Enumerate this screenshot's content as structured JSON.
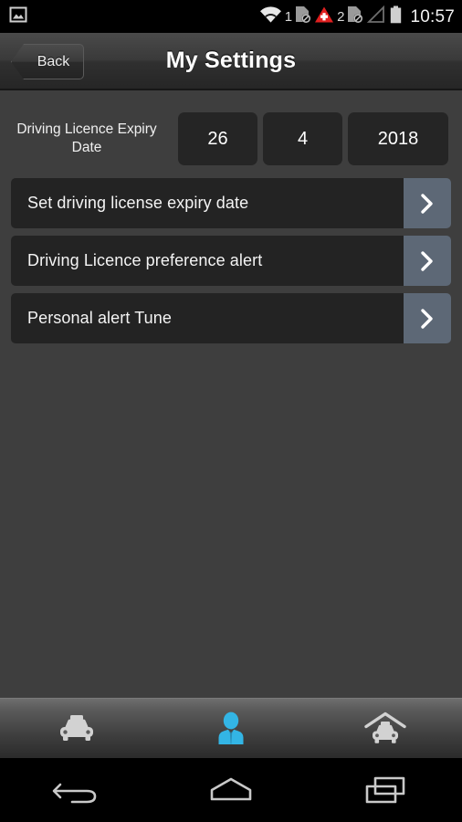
{
  "status_bar": {
    "notification_icon": "photo-icon",
    "wifi_icon": "wifi-icon",
    "sim1_number": "1",
    "sim1_icon": "sim-card-disabled-icon",
    "alert_icon": "emergency-alert-icon",
    "sim2_number": "2",
    "sim2_icon": "sim-card-disabled-icon",
    "signal_icon": "no-signal-icon",
    "battery_icon": "battery-icon",
    "time": "10:57"
  },
  "title_bar": {
    "back_label": "Back",
    "title": "My Settings"
  },
  "settings": {
    "date_label": "Driving Licence Expiry Date",
    "date_day": "26",
    "date_month": "4",
    "date_year": "2018",
    "rows": [
      {
        "label": "Set driving license expiry date",
        "chevron": "chevron-right-icon"
      },
      {
        "label": "Driving Licence preference alert",
        "chevron": "chevron-right-icon"
      },
      {
        "label": "Personal alert Tune",
        "chevron": "chevron-right-icon"
      }
    ]
  },
  "tab_bar": {
    "tabs": [
      {
        "icon": "taxi-icon",
        "active": false
      },
      {
        "icon": "driver-person-icon",
        "active": true
      },
      {
        "icon": "taxi-garage-icon",
        "active": false
      }
    ],
    "active_color": "#33b5e5",
    "inactive_color": "#d2d2d2"
  },
  "nav_bar": {
    "back_icon": "android-back-icon",
    "home_icon": "android-home-icon",
    "recents_icon": "android-recents-icon"
  },
  "colors": {
    "page_background": "#3e3e3e",
    "row_background": "#232323",
    "chevron_background": "#5d6876",
    "date_box_background": "#252525"
  }
}
